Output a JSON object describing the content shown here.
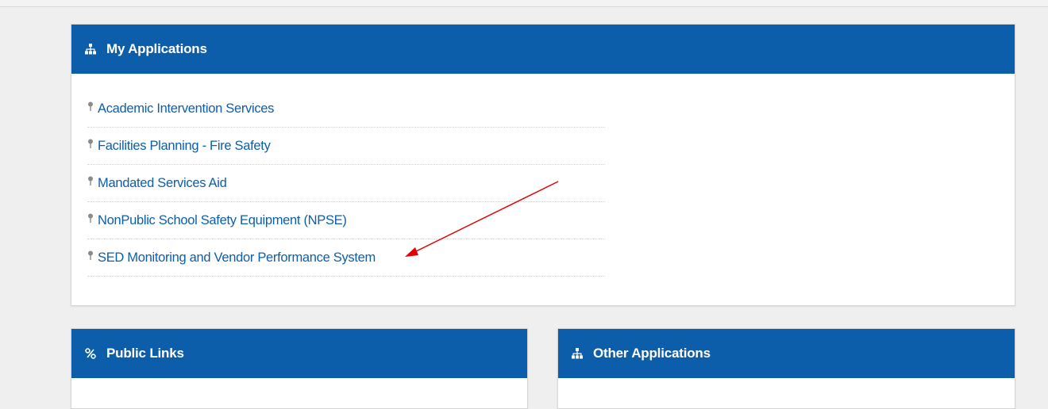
{
  "my_applications": {
    "title": "My Applications",
    "icon": "sitemap-icon",
    "items": [
      {
        "label": "Academic Intervention Services"
      },
      {
        "label": "Facilities Planning - Fire Safety"
      },
      {
        "label": "Mandated Services Aid"
      },
      {
        "label": "NonPublic School Safety Equipment (NPSE)"
      },
      {
        "label": "SED Monitoring and Vendor Performance System"
      }
    ]
  },
  "public_links": {
    "title": "Public Links",
    "icon": "link-icon"
  },
  "other_applications": {
    "title": "Other Applications",
    "icon": "sitemap-icon"
  },
  "colors": {
    "header_blue": "#0d5eaa",
    "link_blue": "#0d5eaa",
    "background": "#efefef",
    "annotation_arrow": "#e00000"
  }
}
